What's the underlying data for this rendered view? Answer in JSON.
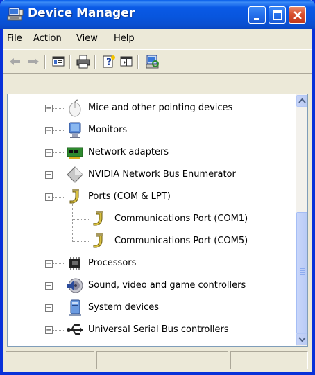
{
  "window": {
    "title": "Device Manager",
    "title_icon": "computer-icon",
    "buttons": [
      "minimize",
      "maximize",
      "close"
    ]
  },
  "menu": {
    "items": [
      {
        "prefix": "",
        "underline": "F",
        "rest": "ile"
      },
      {
        "prefix": "",
        "underline": "A",
        "rest": "ction"
      },
      {
        "prefix": "",
        "underline": "V",
        "rest": "iew"
      },
      {
        "prefix": "",
        "underline": "H",
        "rest": "elp"
      }
    ]
  },
  "toolbar": {
    "tools": [
      "back-icon",
      "forward-icon",
      "properties-view-icon",
      "print-icon",
      "help-icon",
      "show-hide-pane-icon",
      "scan-hardware-icon"
    ]
  },
  "tree": {
    "items": [
      {
        "label": "Mice and other pointing devices",
        "icon": "mouse-icon",
        "expander": "+"
      },
      {
        "label": "Monitors",
        "icon": "monitor-icon",
        "expander": "+"
      },
      {
        "label": "Network adapters",
        "icon": "network-card-icon",
        "expander": "+"
      },
      {
        "label": "NVIDIA Network Bus Enumerator",
        "icon": "diamond-device-icon",
        "expander": "+"
      },
      {
        "label": "Ports (COM & LPT)",
        "icon": "port-icon",
        "expander": "-"
      },
      {
        "label": "Communications Port (COM1)",
        "icon": "port-icon",
        "expander": ""
      },
      {
        "label": "Communications Port (COM5)",
        "icon": "port-icon",
        "expander": ""
      },
      {
        "label": "Processors",
        "icon": "processor-chip-icon",
        "expander": "+"
      },
      {
        "label": "Sound, video and game controllers",
        "icon": "speaker-icon",
        "expander": "+"
      },
      {
        "label": "System devices",
        "icon": "system-computer-icon",
        "expander": "+"
      },
      {
        "label": "Universal Serial Bus controllers",
        "icon": "usb-icon",
        "expander": "+"
      }
    ]
  },
  "colors": {
    "titlebar": "#0A5AE6",
    "window_bg": "#ECE9D8",
    "border": "#0831D9"
  }
}
